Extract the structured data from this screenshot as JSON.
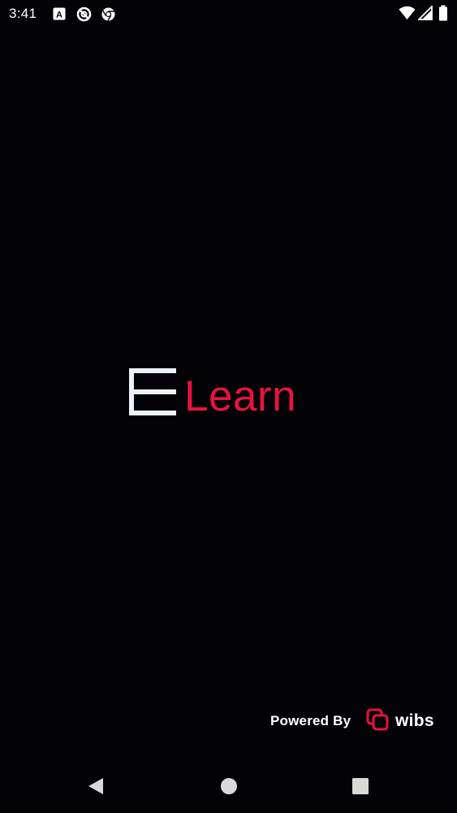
{
  "status_bar": {
    "time": "3:41",
    "left_icons": [
      "a-square-icon",
      "no-sign-icon",
      "chrome-icon"
    ],
    "right_icons": [
      "wifi-icon",
      "signal-icon",
      "battery-icon"
    ]
  },
  "logo": {
    "letter": "E",
    "word": "Learn",
    "accent_color": "#e8123f",
    "letter_color": "#eef2f6"
  },
  "footer": {
    "powered_label": "Powered By",
    "brand_name": "wibs",
    "brand_icon": "wibs-logo-icon"
  },
  "nav_bar": {
    "buttons": [
      "back-icon",
      "home-icon",
      "recents-icon"
    ]
  },
  "colors": {
    "background": "#030206",
    "nav_icon": "#d9d9d9"
  }
}
